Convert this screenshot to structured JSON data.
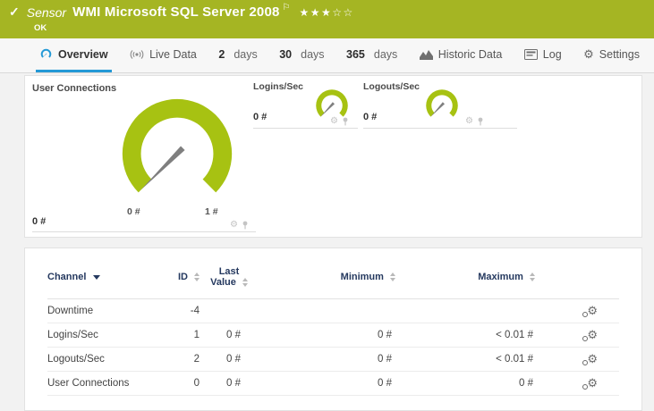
{
  "header": {
    "kind": "Sensor",
    "title": "WMI Microsoft SQL Server 2008",
    "status": "OK",
    "rating_display": "★★★☆☆"
  },
  "tabs": [
    {
      "label": "Overview",
      "icon": "gauge-icon"
    },
    {
      "label": "Live Data",
      "icon": "live-data-icon"
    },
    {
      "num": "2",
      "label": "days"
    },
    {
      "num": "30",
      "label": "days"
    },
    {
      "num": "365",
      "label": "days"
    },
    {
      "label": "Historic Data",
      "icon": "chart-icon"
    },
    {
      "label": "Log",
      "icon": "log-icon"
    },
    {
      "label": "Settings",
      "icon": "gear-icon"
    }
  ],
  "gauges": {
    "user_connections": {
      "title": "User Connections",
      "value": "0 #",
      "scale_min": "0 #",
      "scale_max": "1 #"
    },
    "logins": {
      "title": "Logins/Sec",
      "value": "0 #"
    },
    "logouts": {
      "title": "Logouts/Sec",
      "value": "0 #"
    }
  },
  "chart_data": [
    {
      "type": "gauge",
      "title": "User Connections",
      "value": 0,
      "unit": "#",
      "min": 0,
      "max": 1
    },
    {
      "type": "gauge",
      "title": "Logins/Sec",
      "value": 0,
      "unit": "#"
    },
    {
      "type": "gauge",
      "title": "Logouts/Sec",
      "value": 0,
      "unit": "#"
    }
  ],
  "table": {
    "columns": [
      "Channel",
      "ID",
      "Last Value",
      "Minimum",
      "Maximum"
    ],
    "rows": [
      {
        "channel": "Downtime",
        "id": "-4",
        "last": "",
        "min": "",
        "max": ""
      },
      {
        "channel": "Logins/Sec",
        "id": "1",
        "last": "0 #",
        "min": "0 #",
        "max": "< 0.01 #"
      },
      {
        "channel": "Logouts/Sec",
        "id": "2",
        "last": "0 #",
        "min": "0 #",
        "max": "< 0.01 #"
      },
      {
        "channel": "User Connections",
        "id": "0",
        "last": "0 #",
        "min": "0 #",
        "max": "0 #"
      }
    ]
  },
  "colors": {
    "header_green": "#a5b523",
    "gauge_green": "#a7c212",
    "accent_blue": "#2499d6",
    "table_header_text": "#25395f"
  }
}
